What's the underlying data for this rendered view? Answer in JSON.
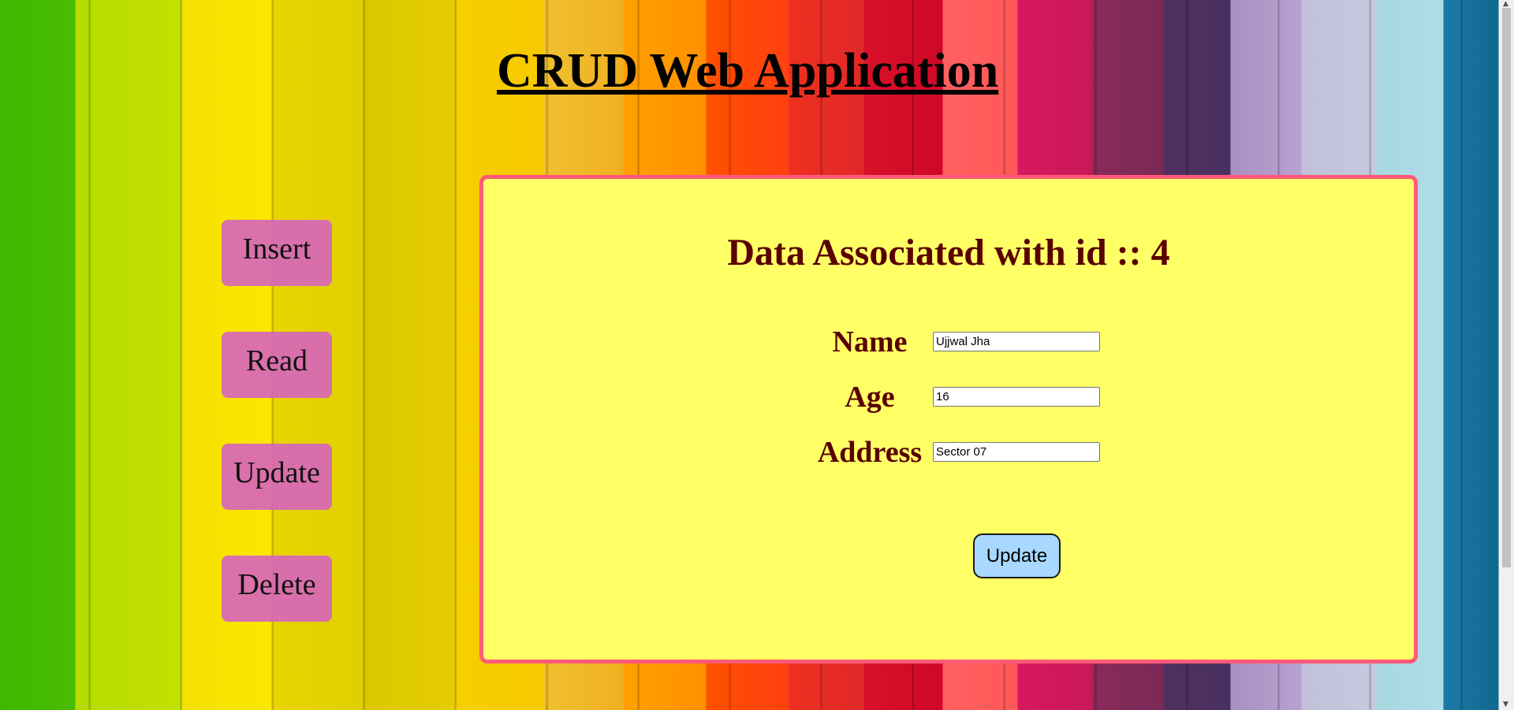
{
  "header": {
    "title": "CRUD Web Application"
  },
  "nav": {
    "items": [
      {
        "label": "Insert"
      },
      {
        "label": "Read"
      },
      {
        "label": "Update"
      },
      {
        "label": "Delete"
      }
    ]
  },
  "panel": {
    "heading": "Data Associated with id :: 4",
    "fields": {
      "name": {
        "label": "Name",
        "value": "Ujjwal Jha"
      },
      "age": {
        "label": "Age",
        "value": "16"
      },
      "address": {
        "label": "Address",
        "value": "Sector 07"
      }
    },
    "submit_label": "Update"
  },
  "colors": {
    "panel_bg": "#ffff66",
    "panel_border": "#ff5a78",
    "nav_button_bg": "#d664be",
    "submit_bg": "#a8d8ff",
    "heading_text": "#5a0000"
  }
}
